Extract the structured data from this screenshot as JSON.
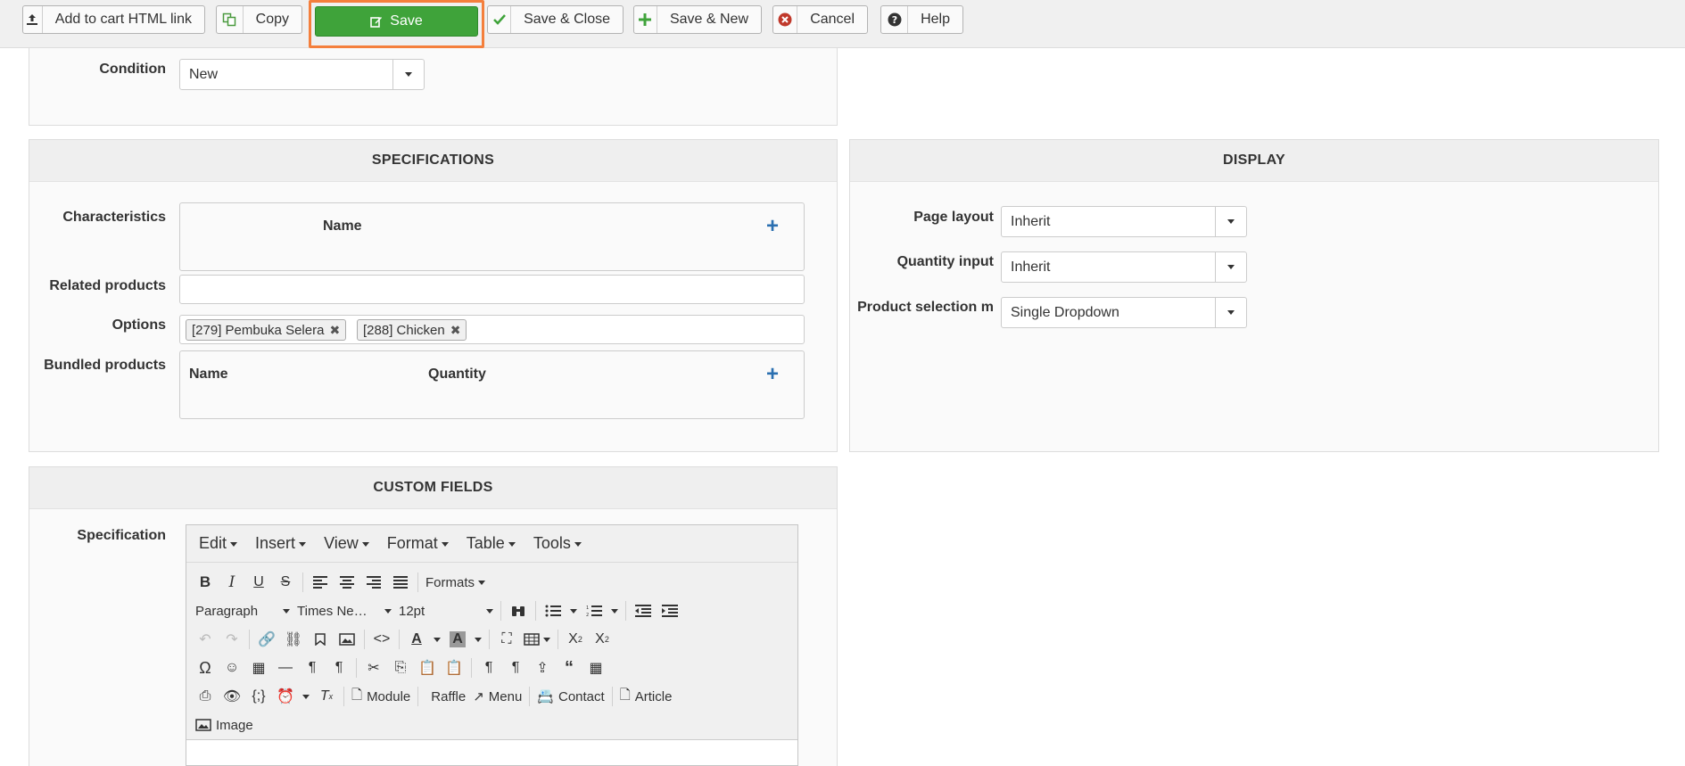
{
  "toolbar": {
    "add_to_cart": "Add to cart HTML link",
    "copy": "Copy",
    "save": "Save",
    "save_close": "Save & Close",
    "save_new": "Save & New",
    "cancel": "Cancel",
    "help": "Help"
  },
  "condition": {
    "label": "Condition",
    "value": "New"
  },
  "specifications": {
    "title": "SPECIFICATIONS",
    "characteristics_label": "Characteristics",
    "characteristics_col": "Name",
    "related_label": "Related products",
    "options_label": "Options",
    "options": [
      "[279] Pembuka Selera",
      "[288] Chicken"
    ],
    "bundled_label": "Bundled products",
    "bundled_cols": [
      "Name",
      "Quantity"
    ]
  },
  "display": {
    "title": "DISPLAY",
    "page_layout_label": "Page layout",
    "page_layout_value": "Inherit",
    "quantity_label": "Quantity input",
    "quantity_value": "Inherit",
    "selection_label": "Product selection m",
    "selection_value": "Single Dropdown"
  },
  "custom_fields": {
    "title": "CUSTOM FIELDS",
    "specification_label": "Specification"
  },
  "editor": {
    "menus": [
      "Edit",
      "Insert",
      "View",
      "Format",
      "Table",
      "Tools"
    ],
    "formats": "Formats",
    "paragraph": "Paragraph",
    "font": "Times Ne…",
    "size": "12pt",
    "module": "Module",
    "raffle": "Raffle",
    "menu": "Menu",
    "contact": "Contact",
    "article": "Article",
    "image": "Image"
  },
  "colors": {
    "save_green": "#3fa33a",
    "highlight": "#f47f3c",
    "accent_blue": "#2a6fb0"
  }
}
